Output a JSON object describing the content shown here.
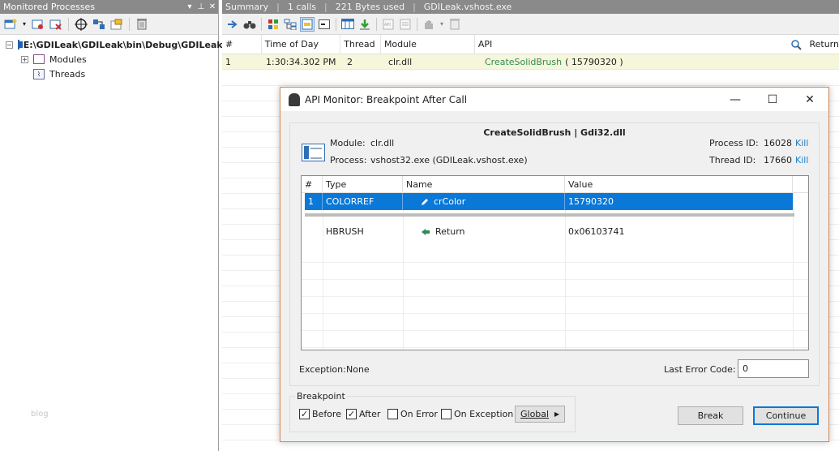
{
  "left_pane": {
    "title": "Monitored Processes",
    "controls": [
      "▾",
      "⊥",
      "✕"
    ],
    "tree": {
      "process": "E:\\GDILeak\\GDILeak\\bin\\Debug\\GDILeak.v",
      "modules": "Modules",
      "threads": "Threads"
    },
    "watermark": "blog"
  },
  "right_pane": {
    "summary": {
      "label": "Summary",
      "calls": "1 calls",
      "bytes": "221 Bytes used",
      "process": "GDILeak.vshost.exe"
    },
    "columns": [
      "#",
      "Time of Day",
      "Thread",
      "Module",
      "API",
      "Return"
    ],
    "rows": [
      {
        "num": "1",
        "time": "1:30:34.302 PM",
        "thread": "2",
        "module": "clr.dll",
        "api_name": "CreateSolidBrush",
        "api_args": "( 15790320 )"
      }
    ]
  },
  "dialog": {
    "title": "API Monitor: Breakpoint After Call",
    "function": "CreateSolidBrush | Gdi32.dll",
    "module_label": "Module:",
    "module_value": "clr.dll",
    "process_label": "Process:",
    "process_value": "vshost32.exe (GDILeak.vshost.exe)",
    "pid_label": "Process ID:",
    "pid_value": "16028",
    "tid_label": "Thread ID:",
    "tid_value": "17660",
    "kill_label": "Kill",
    "param_columns": [
      "#",
      "Type",
      "Name",
      "Value"
    ],
    "params": [
      {
        "num": "1",
        "type": "COLORREF",
        "name": "crColor",
        "value": "15790320"
      }
    ],
    "return_row": {
      "type": "HBRUSH",
      "name": "Return",
      "value": "0x06103741"
    },
    "exception_label": "Exception:",
    "exception_value": "None",
    "last_error_label": "Last Error Code:",
    "last_error_value": "0",
    "breakpoint_group": "Breakpoint",
    "checkboxes": {
      "before": {
        "label": "Before",
        "checked": true
      },
      "after": {
        "label": "After",
        "checked": true
      },
      "on_error": {
        "label": "On Error",
        "checked": false
      },
      "on_exception": {
        "label": "On Exception",
        "checked": false
      }
    },
    "global_label": "Global",
    "break_label": "Break",
    "continue_label": "Continue"
  },
  "colors": {
    "pane_title": "#8a8a8a",
    "selected_row": "#0a78d7",
    "highlight_row": "#f6f6da",
    "api_link": "#2e8b57",
    "kill_link": "#1a7fc8",
    "dialog_border": "#d08a5a"
  },
  "icons": {
    "left_toolbar": [
      "new-process-icon",
      "dropdown-arrow-icon",
      "monitor-icon",
      "remove-icon",
      "target-icon",
      "hook-icon",
      "options-icon",
      "trash-icon"
    ],
    "right_toolbar": [
      "go-icon",
      "find-icon",
      "color-icon",
      "tree-icon",
      "highlight-icon",
      "console-icon",
      "columns-icon",
      "export-icon",
      "api-icon",
      "calls-icon",
      "hand-icon",
      "trash-icon"
    ]
  }
}
